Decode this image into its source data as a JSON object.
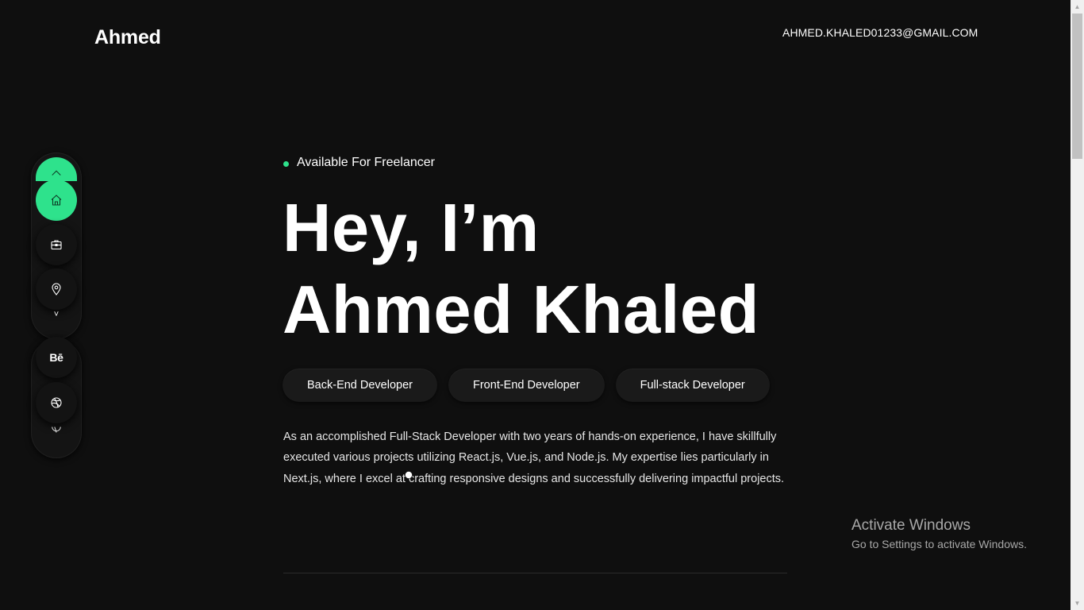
{
  "header": {
    "brand": "Ahmed",
    "email": "AHMED.KHALED01233@GMAIL.COM"
  },
  "sidenav": {
    "items": [
      {
        "icon": "home-icon",
        "active": true
      },
      {
        "icon": "briefcase-icon",
        "active": false
      },
      {
        "icon": "location-pin-icon",
        "active": false
      }
    ],
    "more_glyph": "˅",
    "social": [
      {
        "icon": "behance-icon",
        "label": "Bē"
      },
      {
        "icon": "dribbble-icon"
      }
    ]
  },
  "hero": {
    "status": "Available For Freelancer",
    "title_line1": "Hey, I’m",
    "title_line2": "Ahmed Khaled",
    "roles": [
      "Back-End Developer",
      "Front-End Developer",
      "Full-stack Developer"
    ],
    "bio": "As an accomplished Full-Stack Developer with two years of hands-on experience, I have skillfully executed various projects utilizing React.js, Vue.js, and Node.js. My expertise lies particularly in Next.js, where I excel at crafting responsive designs and successfully delivering impactful projects."
  },
  "watermark": {
    "title": "Activate Windows",
    "subtitle": "Go to Settings to activate Windows."
  },
  "colors": {
    "background": "#0f0f0f",
    "accent": "#2ee28c",
    "chip": "#1a1a1a"
  }
}
